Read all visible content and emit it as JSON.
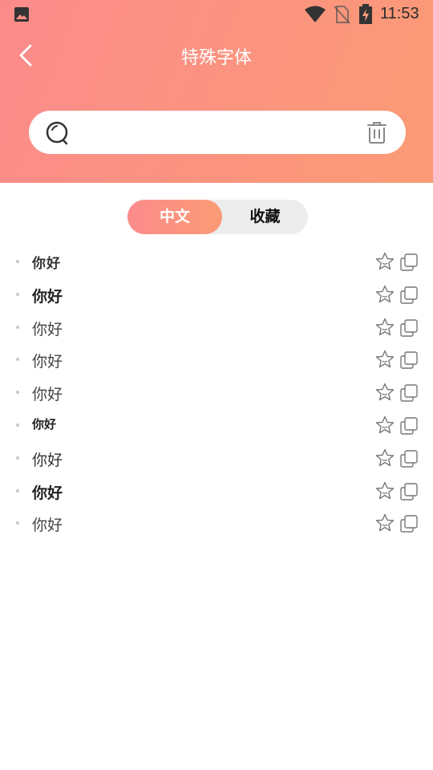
{
  "status_bar": {
    "time": "11:53"
  },
  "header": {
    "title": "特殊字体"
  },
  "search": {
    "value": "",
    "placeholder": ""
  },
  "tabs": [
    {
      "label": "中文",
      "active": true
    },
    {
      "label": "收藏",
      "active": false
    }
  ],
  "font_list": [
    {
      "text": "你好"
    },
    {
      "text": "你好"
    },
    {
      "text": "你好"
    },
    {
      "text": "你好"
    },
    {
      "text": "你好"
    },
    {
      "text": "你好"
    },
    {
      "text": "你好"
    },
    {
      "text": "你好"
    },
    {
      "text": "你好"
    }
  ],
  "colors": {
    "gradient_start": "#fb8b8b",
    "gradient_end": "#fb9b75"
  }
}
